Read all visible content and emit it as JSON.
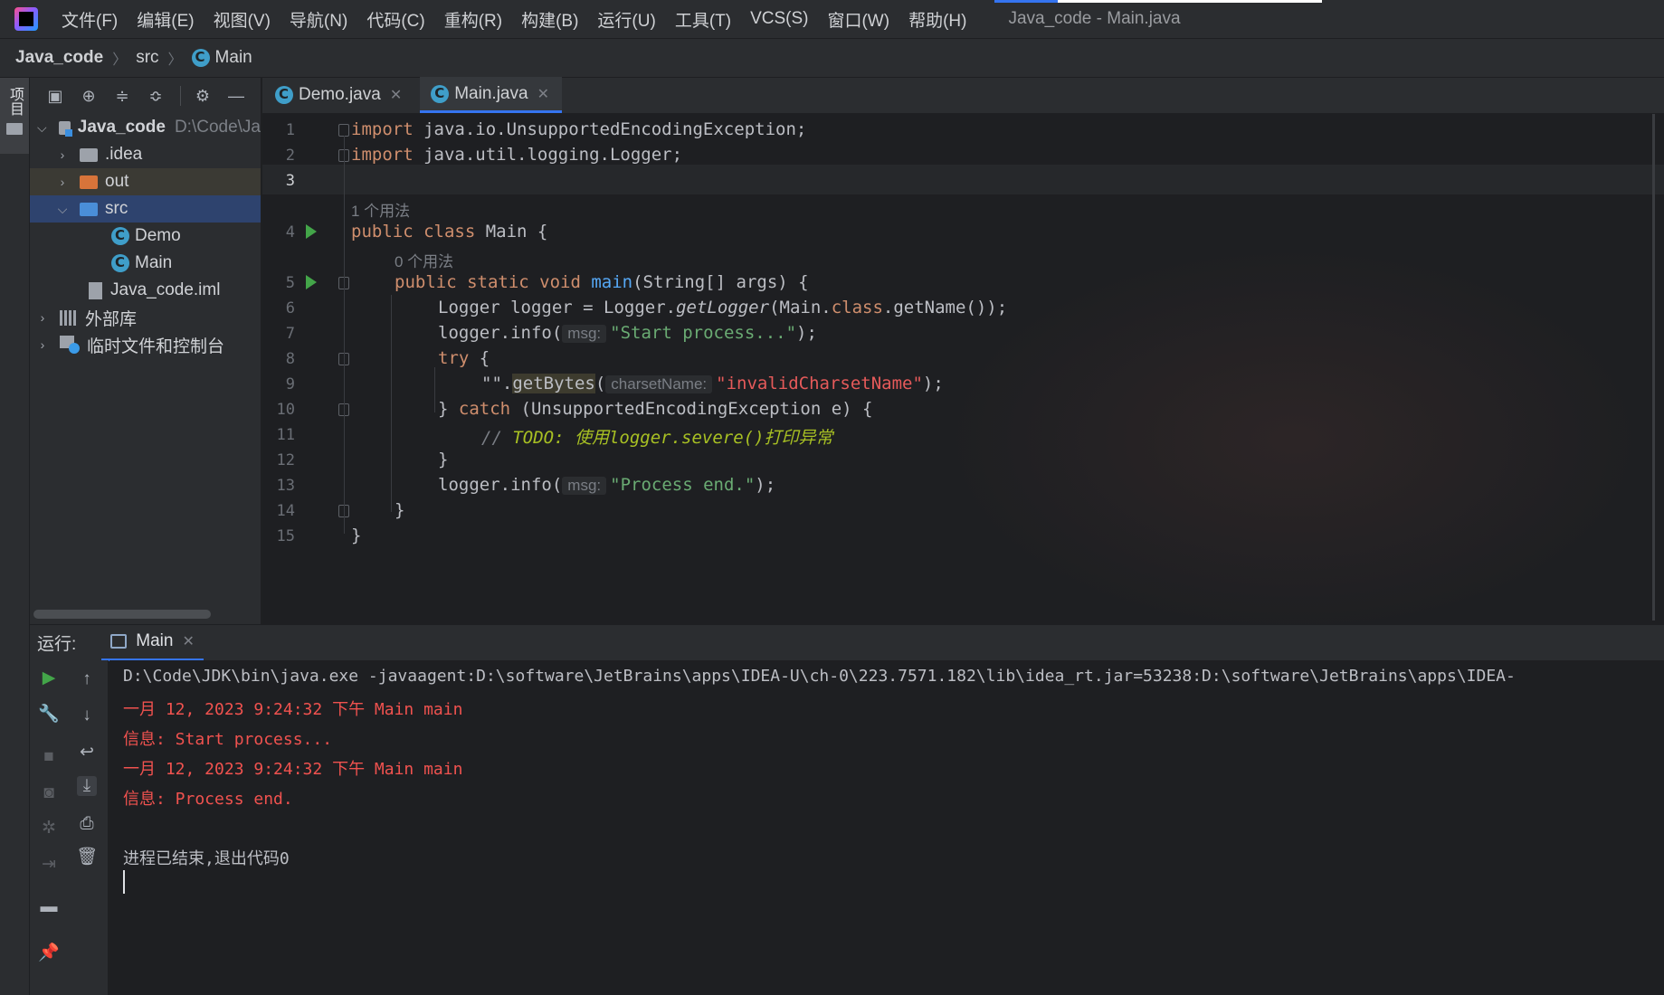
{
  "menubar": {
    "items": [
      "文件(F)",
      "编辑(E)",
      "视图(V)",
      "导航(N)",
      "代码(C)",
      "重构(R)",
      "构建(B)",
      "运行(U)",
      "工具(T)",
      "VCS(S)",
      "窗口(W)",
      "帮助(H)"
    ],
    "window_title": "Java_code - Main.java"
  },
  "breadcrumb": {
    "project": "Java_code",
    "folder": "src",
    "file": "Main"
  },
  "left_strip": {
    "project_label": "项目"
  },
  "project_tree": {
    "root_name": "Java_code",
    "root_path": "D:\\Code\\Ja",
    "idea": ".idea",
    "out": "out",
    "src": "src",
    "demo": "Demo",
    "main": "Main",
    "iml": "Java_code.iml",
    "ext_libs": "外部库",
    "scratches": "临时文件和控制台"
  },
  "editor": {
    "tabs": [
      "Demo.java",
      "Main.java"
    ],
    "active_tab": "Main.java",
    "line_numbers": [
      "1",
      "2",
      "3",
      "4",
      "5",
      "6",
      "7",
      "8",
      "9",
      "10",
      "11",
      "12",
      "13",
      "14",
      "15"
    ],
    "usage_class": "1 个用法",
    "usage_method": "0 个用法",
    "hint_msg": "msg:",
    "hint_charset": "charsetName:",
    "code": {
      "l1_kw": "import",
      "l1_rest": " java.io.UnsupportedEncodingException;",
      "l2_kw": "import",
      "l2_rest": " java.util.logging.Logger;",
      "l4_kw": "public class",
      "l4_rest": " Main {",
      "l5_kw": "public static void",
      "l5_name": " main",
      "l5_rest": "(String[] args) {",
      "l6_a": "Logger logger = Logger.",
      "l6_fn": "getLogger",
      "l6_b": "(Main.",
      "l6_kw": "class",
      "l6_c": ".getName());",
      "l7_a": "logger.info(",
      "l7_str": "\"Start process...\"",
      "l7_b": ");",
      "l8_kw": "try",
      "l8_b": " {",
      "l9_a": "\"\".",
      "l9_fn": "getBytes",
      "l9_b": "(",
      "l9_str": "\"invalidCharsetName\"",
      "l9_c": ");",
      "l10_a": "} ",
      "l10_kw": "catch",
      "l10_b": " (UnsupportedEncodingException e) {",
      "l11_slash": "// ",
      "l11_todo": "TODO: 使用logger.severe()打印异常",
      "l12": "}",
      "l13_a": "logger.info(",
      "l13_str": "\"Process end.\"",
      "l13_b": ");",
      "l14": "}",
      "l15": "}"
    }
  },
  "run_panel": {
    "label": "运行:",
    "tab": "Main",
    "console": [
      "D:\\Code\\JDK\\bin\\java.exe -javaagent:D:\\software\\JetBrains\\apps\\IDEA-U\\ch-0\\223.7571.182\\lib\\idea_rt.jar=53238:D:\\software\\JetBrains\\apps\\IDEA-",
      "一月 12, 2023 9:24:32 下午 Main main",
      "信息: Start process...",
      "一月 12, 2023 9:24:32 下午 Main main",
      "信息: Process end.",
      "进程已结束,退出代码0"
    ]
  },
  "colors": {
    "accent": "#3574f0",
    "keyword": "#cf8e6d",
    "string": "#6aab73",
    "error": "#f0524f",
    "run_green": "#43a549"
  }
}
